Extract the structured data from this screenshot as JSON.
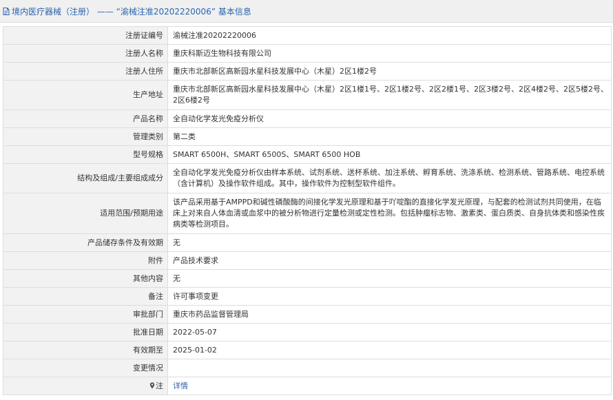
{
  "header": {
    "title": "境内医疗器械（注册） —— “渝械注准20202220006” 基本信息",
    "icon": "document-icon"
  },
  "rows": [
    {
      "label": "注册证编号",
      "value": "渝械注准20202220006"
    },
    {
      "label": "注册人名称",
      "value": "重庆科斯迈生物科技有限公司"
    },
    {
      "label": "注册人住所",
      "value": "重庆市北部新区高新园水星科技发展中心（木星）2区1楼2号"
    },
    {
      "label": "生产地址",
      "value": "重庆市北部新区高新园水星科技发展中心（木星）2区1楼1号、2区1楼2号、2区2楼1号、2区3楼2号、2区4楼2号、2区5楼2号、2区6楼2号"
    },
    {
      "label": "产品名称",
      "value": "全自动化学发光免疫分析仪"
    },
    {
      "label": "管理类别",
      "value": "第二类"
    },
    {
      "label": "型号规格",
      "value": "SMART 6500H、SMART 6500S、SMART 6500 HOB"
    },
    {
      "label": "结构及组成/主要组成成分",
      "value": "全自动化学发光免疫分析仪由样本系统、试剂系统、送杯系统、加注系统、孵育系统、洗涤系统、检测系统、管路系统、电控系统（含计算机）及操作软件组成。其中，操作软件为控制型软件组件。"
    },
    {
      "label": "适用范围/预期用途",
      "value": "该产品采用基于AMPPD和碱性磷酸酶的间接化学发光原理和基于吖啶酯的直接化学发光原理，与配套的检测试剂共同使用，在临床上对来自人体血清或血浆中的被分析物进行定量检测或定性检测。包括肿瘤标志物、激素类、蛋白质类、自身抗体类和感染性疾病类等检测项目。"
    },
    {
      "label": "产品储存条件及有效期",
      "value": "无"
    },
    {
      "label": "附件",
      "value": "产品技术要求"
    },
    {
      "label": "其他内容",
      "value": "无"
    },
    {
      "label": "备注",
      "value": "许可事项变更"
    },
    {
      "label": "审批部门",
      "value": "重庆市药品监督管理局"
    },
    {
      "label": "批准日期",
      "value": "2022-05-07"
    },
    {
      "label": "有效期至",
      "value": "2025-01-02"
    },
    {
      "label": "变更情况",
      "value": ""
    },
    {
      "label": "注",
      "value": "详情",
      "icon": "pin-icon"
    }
  ],
  "colors": {
    "link": "#2a63ad",
    "label_bg": "#f2f2f2",
    "border": "#dddddd",
    "header_bg": "#f0f0f0"
  }
}
